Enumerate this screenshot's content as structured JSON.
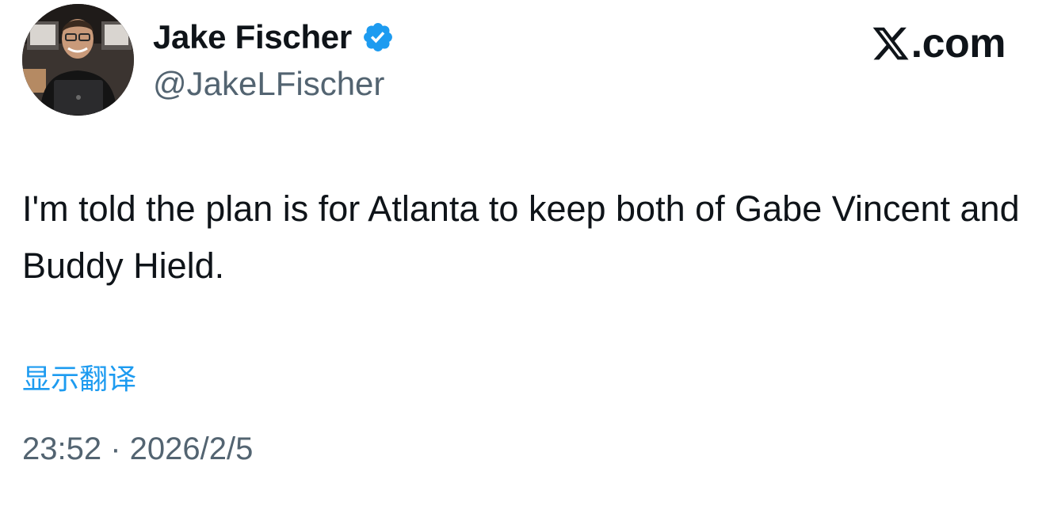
{
  "author": {
    "display_name": "Jake Fischer",
    "handle": "@JakeLFischer",
    "verified": true,
    "verified_color": "#1d9bf0"
  },
  "brand": {
    "icon": "x-logo-icon",
    "suffix": ".com"
  },
  "tweet": {
    "text": "I'm told the plan is for Atlanta to keep both of Gabe Vincent and Buddy Hield.",
    "translate_label": "显示翻译",
    "timestamp": "23:52 · 2026/2/5"
  },
  "colors": {
    "text": "#0f1419",
    "secondary": "#536471",
    "link": "#1d9bf0"
  }
}
